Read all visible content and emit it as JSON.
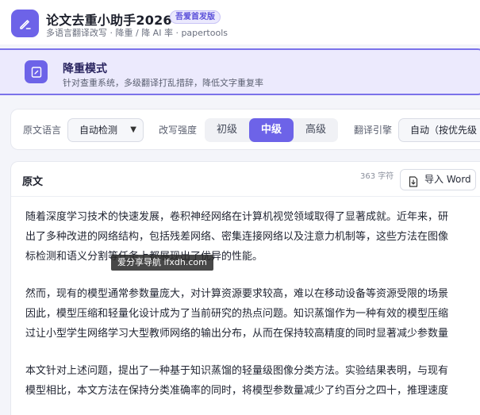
{
  "header": {
    "title": "论文去重小助手2026",
    "badge": "吾爱首发版",
    "subtitle": "多语言翻译改写 · 降重 / 降 AI 率 · papertools",
    "logo_icon": "pencil-edit-icon",
    "accent": "#6d63e8"
  },
  "mode": {
    "title": "降重模式",
    "description": "针对查重系统，多级翻译打乱措辞，降低文字重复率",
    "icon": "document-edit-icon"
  },
  "controls": {
    "source_lang_label": "原文语言",
    "source_lang_value": "自动检测",
    "strength_label": "改写强度",
    "strength_options": [
      "初级",
      "中级",
      "高级"
    ],
    "strength_selected": "中级",
    "engine_label": "翻译引擎",
    "engine_value": "自动（按优先级"
  },
  "panel": {
    "title": "原文",
    "char_count": "363 字符",
    "import_label": "导入 Word",
    "paragraphs": [
      {
        "lines": [
          "随着深度学习技术的快速发展，卷积神经网络在计算机视觉领域取得了显著成就。近年来，研",
          "出了多种改进的网络结构，包括残差网络、密集连接网络以及注意力机制等，这些方法在图像",
          "标检测和语义分割等任务上都展现出了优异的性能。"
        ]
      },
      {
        "lines": [
          "然而，现有的模型通常参数量庞大，对计算资源要求较高，难以在移动设备等资源受限的场景",
          "因此，模型压缩和轻量化设计成为了当前研究的热点问题。知识蒸馏作为一种有效的模型压缩",
          "过让小型学生网络学习大型教师网络的输出分布，从而在保持较高精度的同时显著减少参数量"
        ]
      },
      {
        "lines": [
          "本文针对上述问题，提出了一种基于知识蒸馏的轻量级图像分类方法。实验结果表明，与现有",
          "模型相比，本文方法在保持分类准确率的同时，将模型参数量减少了约百分之四十，推理速度"
        ]
      }
    ]
  },
  "watermark": "爱分享导航 ifxdh.com"
}
